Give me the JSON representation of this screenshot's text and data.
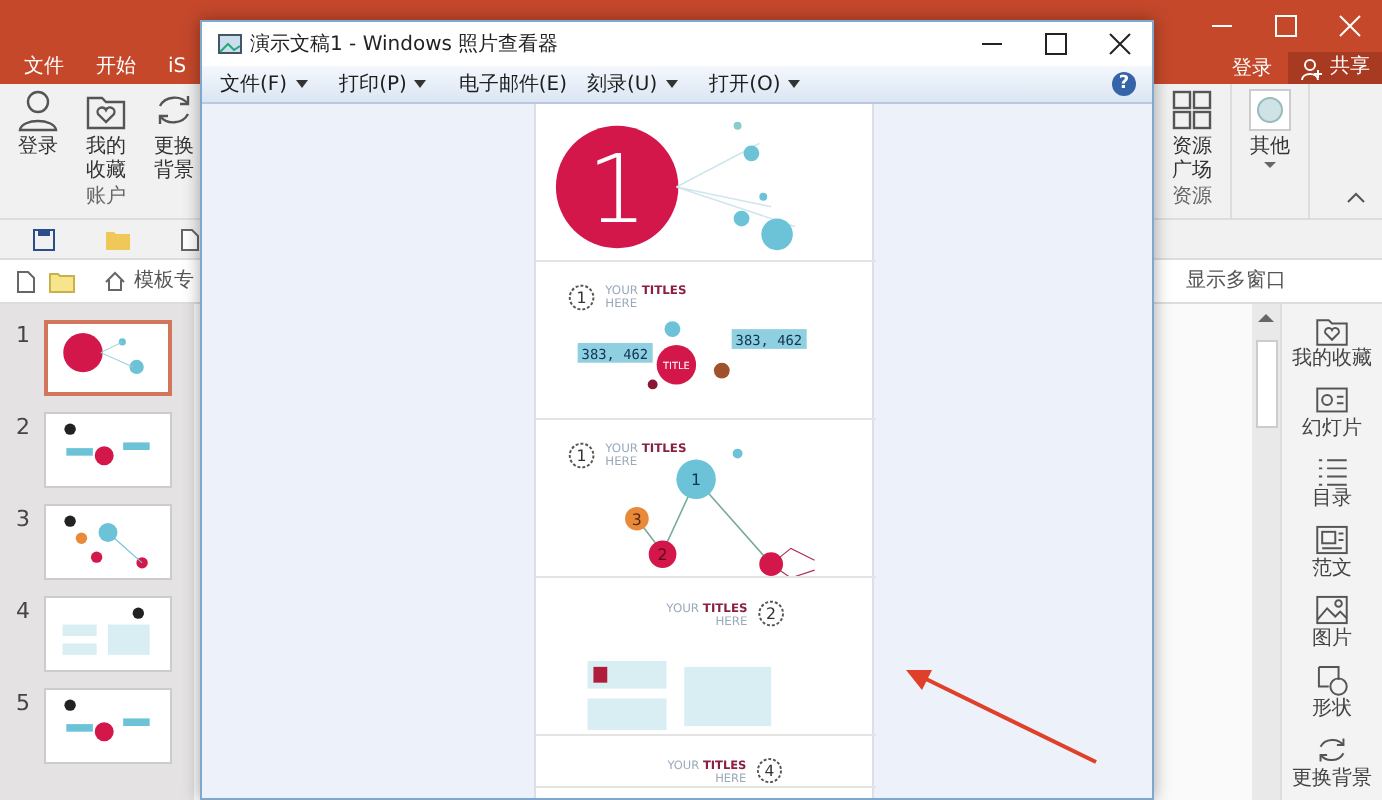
{
  "app": {
    "ribbon_tabs": [
      {
        "label": "文件",
        "selected": false
      },
      {
        "label": "开始",
        "selected": false
      },
      {
        "label": "iS",
        "selected": false
      }
    ],
    "login": "登录",
    "share": "共享",
    "ribbon_groups": [
      {
        "label": "账户",
        "buttons": [
          {
            "label": "登录",
            "kind": "user"
          },
          {
            "label": "我的收藏",
            "kind": "favorite"
          },
          {
            "label": "更换背景",
            "kind": "refresh"
          }
        ]
      },
      {
        "label": "资源",
        "buttons": [
          {
            "label": "资源广场",
            "kind": "grid"
          }
        ]
      },
      {
        "buttons": [
          {
            "label": "其他",
            "kind": "circle"
          }
        ]
      }
    ],
    "template_zone": "模板专",
    "multi_window": "显示多窗口",
    "slides": [
      {
        "number": "1",
        "selected": true,
        "kind": "cover"
      },
      {
        "number": "2",
        "selected": false,
        "kind": "bubbles"
      },
      {
        "number": "3",
        "selected": false,
        "kind": "network"
      },
      {
        "number": "4",
        "selected": false,
        "kind": "panels"
      },
      {
        "number": "5",
        "selected": false,
        "kind": "bubbles"
      }
    ],
    "side_panel": [
      {
        "label": "我的收藏",
        "kind": "favorite"
      },
      {
        "label": "幻灯片",
        "kind": "slide"
      },
      {
        "label": "目录",
        "kind": "list"
      },
      {
        "label": "范文",
        "kind": "document"
      },
      {
        "label": "图片",
        "kind": "picture"
      },
      {
        "label": "形状",
        "kind": "shape"
      },
      {
        "label": "更换背景",
        "kind": "refresh"
      }
    ]
  },
  "viewer": {
    "title": "演示文稿1 - Windows 照片查看器",
    "help": "?",
    "menu": [
      {
        "label": "文件(F)",
        "dropdown": true
      },
      {
        "label": "打印(P)",
        "dropdown": true
      },
      {
        "label": "电子邮件(E)",
        "dropdown": false
      },
      {
        "label": "刻录(U)",
        "dropdown": true
      },
      {
        "label": "打开(O)",
        "dropdown": true
      }
    ],
    "image_slides": [
      {
        "kind": "cover",
        "number": "1"
      },
      {
        "kind": "bubbles",
        "badge": "1",
        "title_lead": "YOUR",
        "title_bold": "TITLES",
        "subtitle": "HERE",
        "values": [
          "383, 462",
          "383, 462"
        ],
        "center": "TITLE"
      },
      {
        "kind": "network",
        "badge": "1",
        "title_lead": "YOUR",
        "title_bold": "TITLES",
        "subtitle": "HERE",
        "nodes": [
          "1",
          "2",
          "3"
        ]
      },
      {
        "kind": "panels",
        "badge": "2",
        "title_lead": "YOUR",
        "title_bold": "TITLES",
        "subtitle": "HERE"
      },
      {
        "kind": "partial",
        "badge": "4",
        "title_lead": "YOUR",
        "title_bold": "TITLES",
        "subtitle": "HERE"
      }
    ]
  }
}
